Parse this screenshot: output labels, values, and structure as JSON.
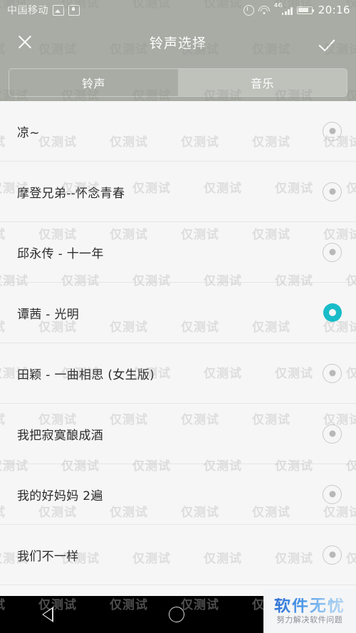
{
  "status_bar": {
    "carrier": "中国移动",
    "icons": [
      "gallery-icon",
      "download-icon",
      "alarm-icon",
      "wifi-icon",
      "signal-icon",
      "battery-icon"
    ],
    "network_type": "4G",
    "clock": "20:16"
  },
  "header": {
    "title": "铃声选择",
    "close_icon": "close-icon",
    "confirm_icon": "check-icon"
  },
  "tabs": [
    {
      "label": "铃声",
      "selected": false
    },
    {
      "label": "音乐",
      "selected": true
    }
  ],
  "list": {
    "items": [
      {
        "label": "凉~",
        "selected": false
      },
      {
        "label": "摩登兄弟--怀念青春",
        "selected": false
      },
      {
        "label": "邱永传 - 十一年",
        "selected": false
      },
      {
        "label": "谭茜 - 光明",
        "selected": true
      },
      {
        "label": "田颖 - 一曲相思 (女生版)",
        "selected": false
      },
      {
        "label": "我把寂寞酿成酒",
        "selected": false
      },
      {
        "label": "我的好妈妈  2遍",
        "selected": false
      },
      {
        "label": "我们不一样",
        "selected": false
      }
    ]
  },
  "navbar": {
    "back": "back-icon",
    "home": "home-icon",
    "recents": "recents-icon"
  },
  "watermark": {
    "text": "仅测试",
    "logo_title": "软件无忧",
    "logo_subtitle": "努力解决软件问题"
  },
  "colors": {
    "header_bg": "#a9aca4",
    "accent": "#18bcc8",
    "list_bg": "#f6f6f6",
    "navbar_bg": "#000000"
  }
}
